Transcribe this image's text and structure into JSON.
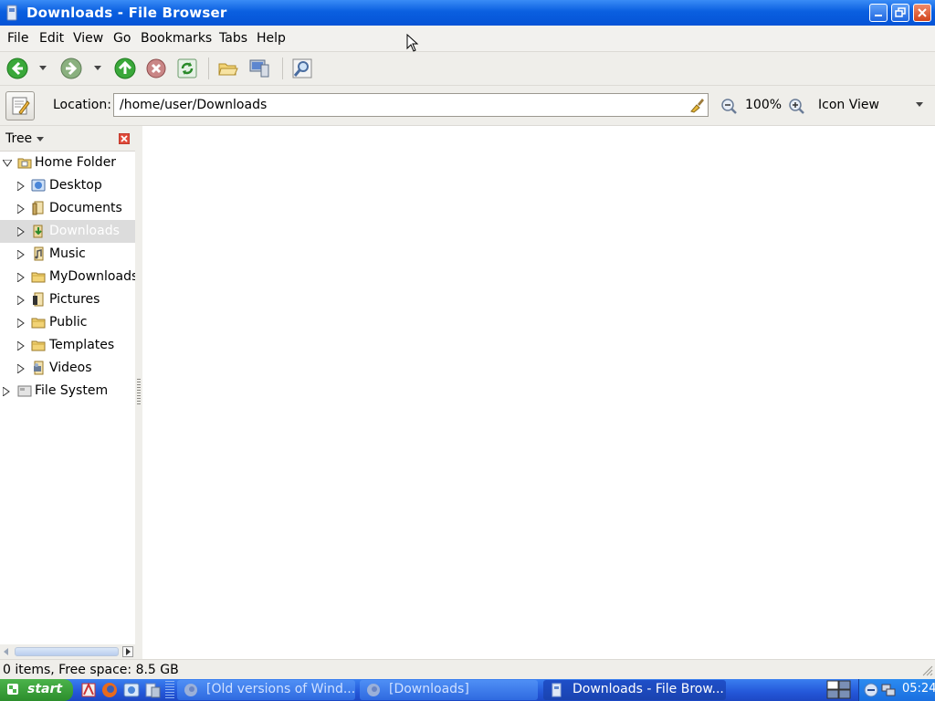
{
  "window": {
    "title": "Downloads - File Browser"
  },
  "menubar": {
    "items": [
      "File",
      "Edit",
      "View",
      "Go",
      "Bookmarks",
      "Tabs",
      "Help"
    ]
  },
  "toolbar": {
    "buttons": [
      "back",
      "forward",
      "up",
      "stop",
      "reload",
      "open-folder",
      "computer",
      "search"
    ]
  },
  "location": {
    "label": "Location:",
    "path": "/home/user/Downloads",
    "zoom": "100%",
    "view_mode": "Icon View"
  },
  "sidebar": {
    "title": "Tree",
    "items": [
      {
        "label": "Home Folder",
        "level": 0,
        "expanded": true,
        "icon": "home-folder-icon"
      },
      {
        "label": "Desktop",
        "level": 1,
        "icon": "desktop-icon"
      },
      {
        "label": "Documents",
        "level": 1,
        "icon": "documents-icon"
      },
      {
        "label": "Downloads",
        "level": 1,
        "icon": "downloads-icon",
        "selected": true
      },
      {
        "label": "Music",
        "level": 1,
        "icon": "music-icon"
      },
      {
        "label": "MyDownloads",
        "level": 1,
        "icon": "folder-icon"
      },
      {
        "label": "Pictures",
        "level": 1,
        "icon": "pictures-icon"
      },
      {
        "label": "Public",
        "level": 1,
        "icon": "folder-icon"
      },
      {
        "label": "Templates",
        "level": 1,
        "icon": "folder-icon"
      },
      {
        "label": "Videos",
        "level": 1,
        "icon": "videos-icon"
      },
      {
        "label": "File System",
        "level": 0,
        "icon": "drive-icon"
      }
    ]
  },
  "status": {
    "text": "0 items, Free space: 8.5 GB"
  },
  "taskbar": {
    "start_label": "start",
    "tasks": [
      {
        "label": "[Old versions of Wind...",
        "active": false
      },
      {
        "label": "[Downloads]",
        "active": false
      },
      {
        "label": "Downloads - File Brow...",
        "active": true
      }
    ],
    "clock": "05:24"
  },
  "colors": {
    "titlebar": "#0a5fe0",
    "taskbar": "#2457d9",
    "start": "#3a9e3a",
    "selection": "#dcdcdc"
  }
}
